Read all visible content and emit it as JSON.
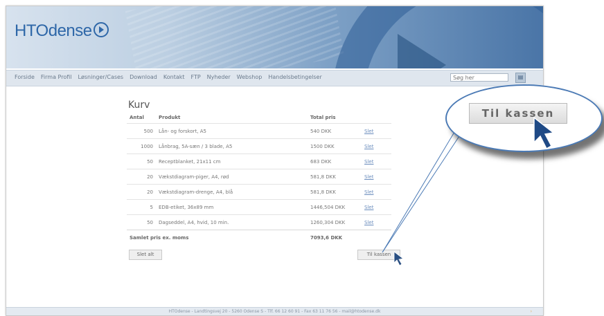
{
  "site": {
    "logo_text": "HTOdense"
  },
  "nav": {
    "items": [
      "Forside",
      "Firma Profil",
      "Løsninger/Cases",
      "Download",
      "Kontakt",
      "FTP",
      "Nyheder",
      "Webshop",
      "Handelsbetingelser"
    ],
    "search_value": "Søg her"
  },
  "cart": {
    "title": "Kurv",
    "headers": {
      "qty": "Antal",
      "product": "Produkt",
      "total": "Total pris"
    },
    "rows": [
      {
        "qty": "500",
        "product": "Lån- og forskort, A5",
        "price": "540 DKK",
        "action": "Slet"
      },
      {
        "qty": "1000",
        "product": "Lånbrag, 5A-sæn / 3 blade, A5",
        "price": "1500 DKK",
        "action": "Slet"
      },
      {
        "qty": "50",
        "product": "Receptblanket, 21x11 cm",
        "price": "683 DKK",
        "action": "Slet"
      },
      {
        "qty": "20",
        "product": "Vækstdiagram-piger, A4, rød",
        "price": "581,8 DKK",
        "action": "Slet"
      },
      {
        "qty": "20",
        "product": "Vækstdiagram-drenge, A4, blå",
        "price": "581,8 DKK",
        "action": "Slet"
      },
      {
        "qty": "5",
        "product": "EDB-etiket, 36x89 mm",
        "price": "1446,504 DKK",
        "action": "Slet"
      },
      {
        "qty": "50",
        "product": "Dagseddel, A4, hvid, 10 min.",
        "price": "1260,304 DKK",
        "action": "Slet"
      }
    ],
    "total_label": "Samlet pris ex. moms",
    "total_value": "7093,6 DKK",
    "clear_label": "Slet alt",
    "checkout_label": "Til kassen"
  },
  "footer": {
    "text": "HTOdense - Landtingsvej 20 - 5260 Odense S - Tlf. 66 12 60 91 - Fax 63 11 76 56 - mail@htodense.dk",
    "arrow": "›"
  },
  "callout": {
    "label": "Til kassen"
  }
}
